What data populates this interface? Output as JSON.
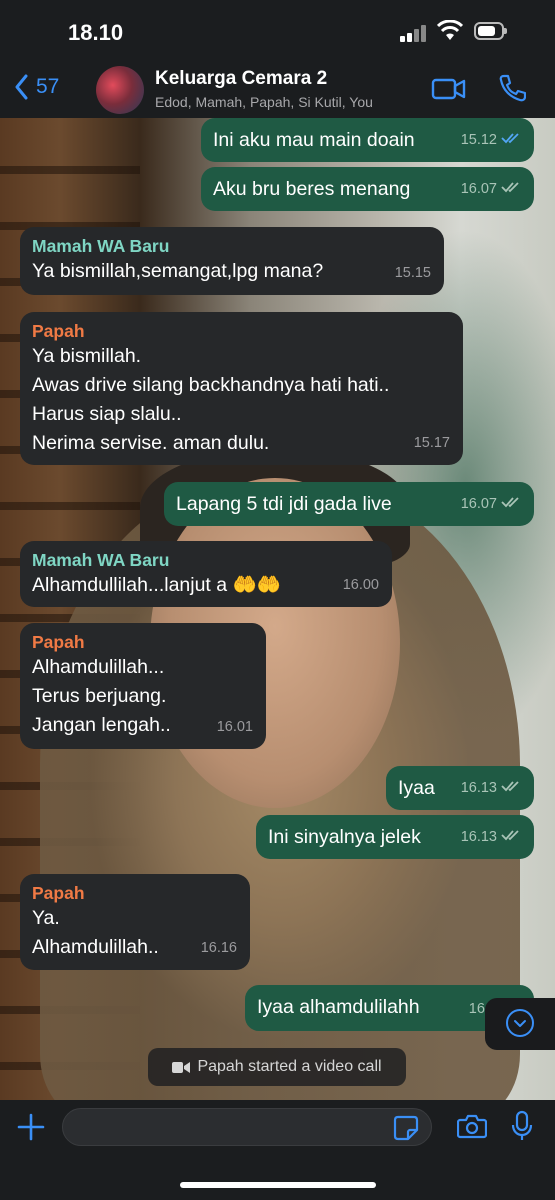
{
  "status_bar": {
    "time": "18.10",
    "battery_level": 0.75
  },
  "header": {
    "back_count": "57",
    "chat_title": "Keluarga Cemara 2",
    "members": "Edod, Mamah, Papah, Si Kutil, You",
    "accent_color": "#3a8ff6",
    "icons": [
      "chevron-left-icon",
      "video-camera-icon",
      "phone-icon"
    ]
  },
  "messages": [
    {
      "dir": "out",
      "lines": [
        "Ini aku mau main doain"
      ],
      "time": "15.12",
      "read": true
    },
    {
      "dir": "out",
      "lines": [
        "Aku bru beres menang"
      ],
      "time": "16.07",
      "read": false
    },
    {
      "dir": "in",
      "sender": "Mamah WA Baru",
      "sender_color": "#7fd6c4",
      "lines": [
        "Ya bismillah,semangat,lpg mana?"
      ],
      "time": "15.15"
    },
    {
      "dir": "in",
      "sender": "Papah",
      "sender_color": "#f07a45",
      "lines": [
        "Ya bismillah.",
        "Awas drive silang backhandnya hati hati..",
        "Harus siap slalu..",
        "Nerima servise. aman dulu."
      ],
      "time": "15.17"
    },
    {
      "dir": "out",
      "lines": [
        "Lapang 5 tdi jdi gada live"
      ],
      "time": "16.07",
      "read": false
    },
    {
      "dir": "in",
      "sender": "Mamah WA Baru",
      "sender_color": "#7fd6c4",
      "lines": [
        "Alhamdullilah...lanjut a 🤲🤲"
      ],
      "time": "16.00"
    },
    {
      "dir": "in",
      "sender": "Papah",
      "sender_color": "#f07a45",
      "lines": [
        "Alhamdulillah...",
        "Terus berjuang.",
        "Jangan lengah.."
      ],
      "time": "16.01"
    },
    {
      "dir": "out",
      "lines": [
        "Iyaa"
      ],
      "time": "16.13",
      "read": false
    },
    {
      "dir": "out",
      "lines": [
        "Ini sinyalnya jelek"
      ],
      "time": "16.13",
      "read": false
    },
    {
      "dir": "in",
      "sender": "Papah",
      "sender_color": "#f07a45",
      "lines": [
        "Ya.",
        "Alhamdulillah.."
      ],
      "time": "16.16"
    },
    {
      "dir": "out",
      "lines": [
        "Iyaa alhamdulilahh"
      ],
      "time": "16.1",
      "read": false
    }
  ],
  "system_message": "Papah started a video call",
  "composer": {
    "placeholder": ""
  },
  "colors": {
    "incoming_bubble": "#26282a",
    "outgoing_bubble": "#1f5a44",
    "read_tick": "#53a6f5",
    "unread_tick": "#a9c4b7"
  }
}
